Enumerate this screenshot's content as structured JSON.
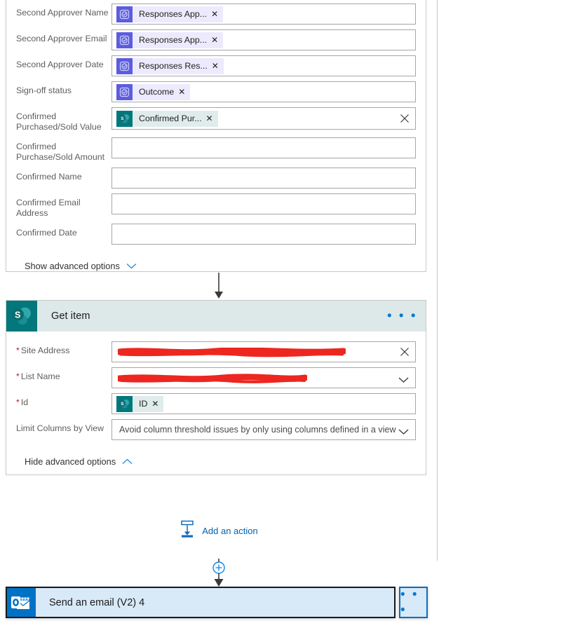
{
  "top_card": {
    "rows": [
      {
        "label": "Second Approver Name",
        "token": {
          "text": "Responses App...",
          "kind": "approval"
        },
        "clear": false
      },
      {
        "label": "Second Approver Email",
        "token": {
          "text": "Responses App...",
          "kind": "approval"
        },
        "clear": false
      },
      {
        "label": "Second Approver Date",
        "token": {
          "text": "Responses Res...",
          "kind": "approval"
        },
        "clear": false
      },
      {
        "label": "Sign-off status",
        "token": {
          "text": "Outcome",
          "kind": "approval"
        },
        "clear": false
      },
      {
        "label": "Confirmed Purchased/Sold Value",
        "token": {
          "text": "Confirmed Pur...",
          "kind": "sharepoint"
        },
        "clear": true
      },
      {
        "label": "Confirmed Purchase/Sold Amount",
        "token": null,
        "clear": false
      },
      {
        "label": "Confirmed Name",
        "token": null,
        "clear": false
      },
      {
        "label": "Confirmed Email Address",
        "token": null,
        "clear": false
      },
      {
        "label": "Confirmed Date",
        "token": null,
        "clear": false
      }
    ],
    "advanced_toggle_label": "Show advanced options"
  },
  "get_item_card": {
    "title": "Get item",
    "icon": "sharepoint-icon",
    "ellipsis_label": "• • •",
    "rows": [
      {
        "label": "Site Address",
        "required": true,
        "value": "",
        "redacted": true,
        "redact_width": 325,
        "control": "clear"
      },
      {
        "label": "List Name",
        "required": true,
        "value": "",
        "redacted": true,
        "redact_width": 270,
        "control": "chevron"
      },
      {
        "label": "Id",
        "required": true,
        "token": {
          "text": "ID",
          "kind": "sharepoint"
        },
        "control": "none"
      },
      {
        "label": "Limit Columns by View",
        "required": false,
        "placeholder": "Avoid column threshold issues by only using columns defined in a view",
        "control": "chevron"
      }
    ],
    "advanced_toggle_label": "Hide advanced options"
  },
  "add_action": {
    "label": "Add an action",
    "icon": "insert-action-icon"
  },
  "bottom_card": {
    "title": "Send an email (V2) 4",
    "icon": "outlook-icon",
    "ellipsis_label": "• • •",
    "selected": true
  },
  "colors": {
    "card_header_bg": "#dce9e8",
    "accent_blue": "#0078d4",
    "link_blue": "#0063b1",
    "approval_purple": "#5c5ce0",
    "approval_token_bg": "#eceafc",
    "sharepoint_teal": "#03787c",
    "sharepoint_token_bg": "#dfeceb",
    "outlook_blue": "#0072c6",
    "selected_card_bg": "#d8e9f8",
    "redaction_red": "#ee2620",
    "required_red": "#a4262c",
    "border_grey": "#c8c8c8"
  }
}
